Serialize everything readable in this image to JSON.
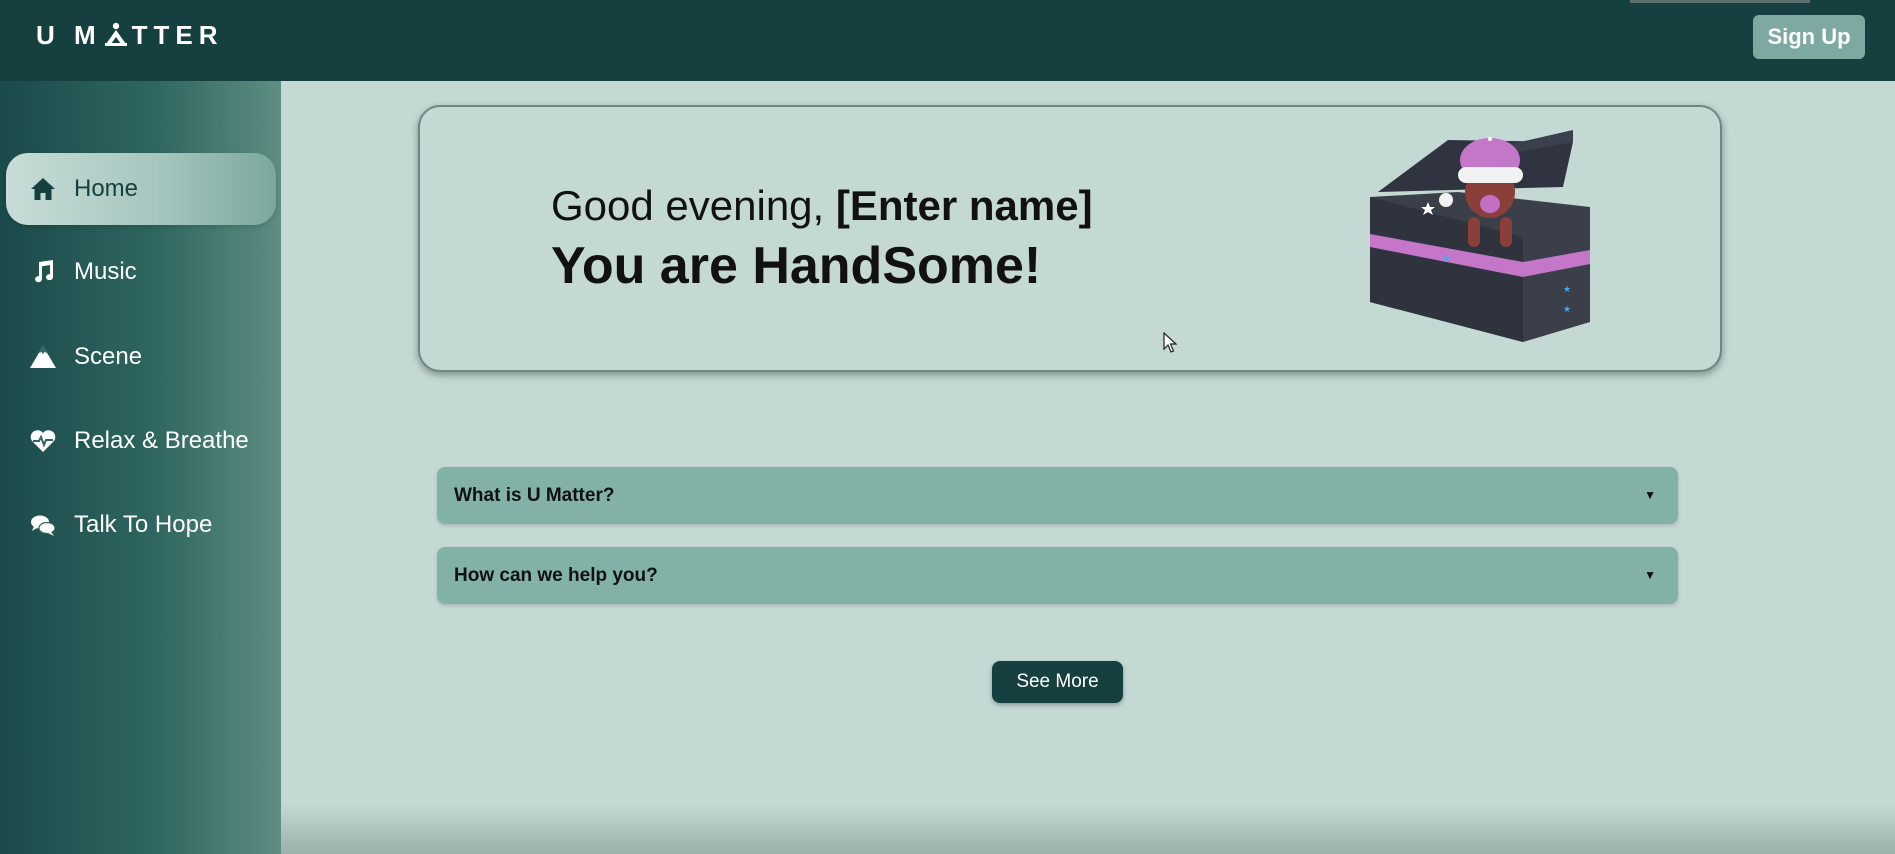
{
  "header": {
    "logo_text_left": "U M",
    "logo_text_right": "TTER",
    "signup_label": "Sign Up"
  },
  "sidebar": {
    "items": [
      {
        "label": "Home",
        "icon": "home-icon",
        "active": true
      },
      {
        "label": "Music",
        "icon": "music-note-icon",
        "active": false
      },
      {
        "label": "Scene",
        "icon": "mountain-icon",
        "active": false
      },
      {
        "label": "Relax & Breathe",
        "icon": "heartbeat-icon",
        "active": false
      },
      {
        "label": "Talk To Hope",
        "icon": "chat-bubbles-icon",
        "active": false
      }
    ]
  },
  "hero": {
    "greeting_prefix": "Good evening, ",
    "greeting_name": "[Enter name]",
    "compliment": "You are HandSome!",
    "illustration": "character-in-box-illustration"
  },
  "faq": [
    {
      "question": "What is U Matter?"
    },
    {
      "question": "How can we help you?"
    }
  ],
  "see_more_label": "See More",
  "colors": {
    "header_bg": "#163f40",
    "page_bg": "#c5d9d4",
    "accordion_bg": "#82b2a7",
    "signup_bg": "#7ea8a2",
    "button_dark": "#163f40"
  }
}
